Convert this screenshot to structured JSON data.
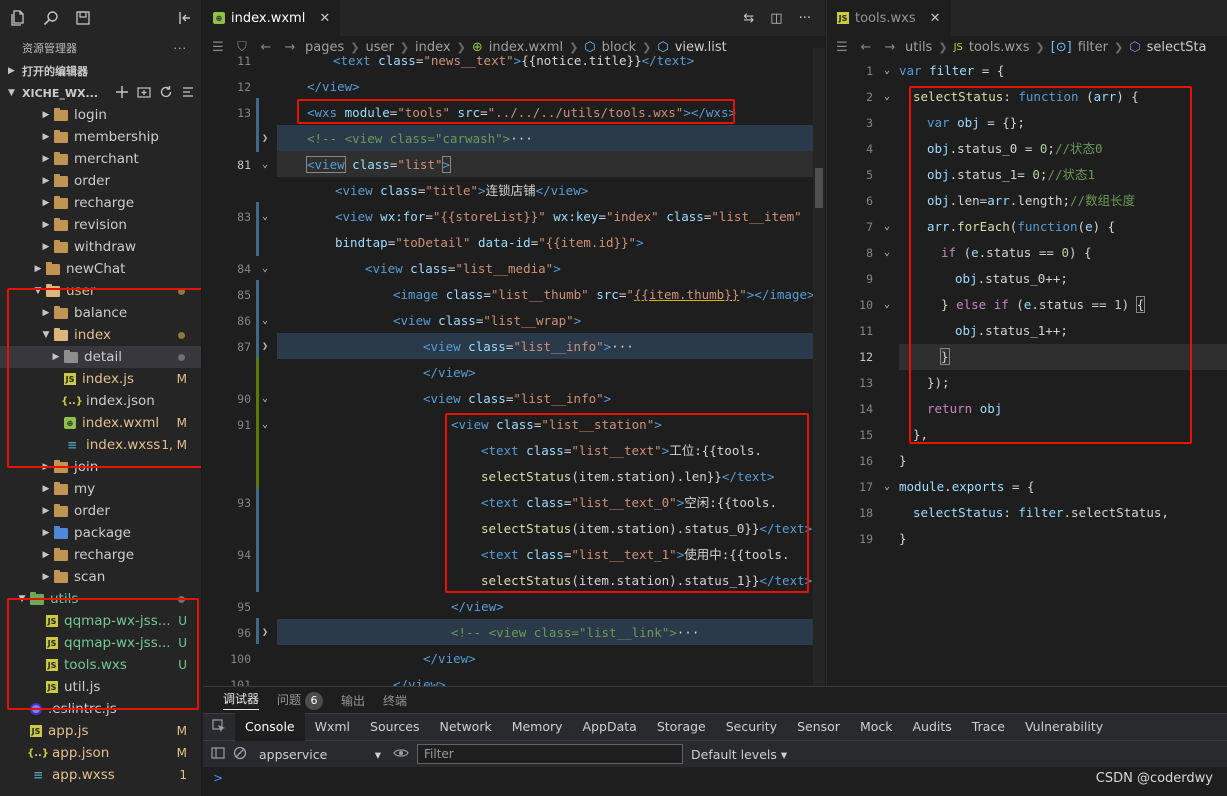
{
  "explorer": {
    "title": "资源管理器",
    "more": "···",
    "open_editors": "打开的编辑器",
    "workspace": "XICHE_WX...",
    "tree": [
      {
        "label": "login",
        "type": "folder",
        "depth": 2
      },
      {
        "label": "membership",
        "type": "folder",
        "depth": 2
      },
      {
        "label": "merchant",
        "type": "folder",
        "depth": 2
      },
      {
        "label": "order",
        "type": "folder",
        "depth": 2
      },
      {
        "label": "recharge",
        "type": "folder",
        "depth": 2
      },
      {
        "label": "revision",
        "type": "folder",
        "depth": 2
      },
      {
        "label": "withdraw",
        "type": "folder",
        "depth": 2
      },
      {
        "label": "newChat",
        "type": "folder",
        "depth": 1
      },
      {
        "label": "user",
        "type": "folder-open",
        "depth": 1,
        "dot": true
      },
      {
        "label": "balance",
        "type": "folder",
        "depth": 2
      },
      {
        "label": "index",
        "type": "folder-open",
        "depth": 2,
        "dot": true
      },
      {
        "label": "detail",
        "type": "folder-dark",
        "depth": 3,
        "dot": true
      },
      {
        "label": "index.js",
        "type": "js",
        "depth": 3,
        "badge": "M"
      },
      {
        "label": "index.json",
        "type": "json",
        "depth": 3
      },
      {
        "label": "index.wxml",
        "type": "wxml",
        "depth": 3,
        "badge": "M"
      },
      {
        "label": "index.wxss",
        "type": "wxss",
        "depth": 3,
        "badge": "1, M"
      },
      {
        "label": "join",
        "type": "folder",
        "depth": 2
      },
      {
        "label": "my",
        "type": "folder",
        "depth": 2
      },
      {
        "label": "order",
        "type": "folder",
        "depth": 2
      },
      {
        "label": "package",
        "type": "folder-blue",
        "depth": 2
      },
      {
        "label": "recharge",
        "type": "folder",
        "depth": 2
      },
      {
        "label": "scan",
        "type": "folder",
        "depth": 2
      },
      {
        "label": "utils",
        "type": "folder-green",
        "depth": 0,
        "dot": true
      },
      {
        "label": "qqmap-wx-jss...",
        "type": "js",
        "depth": 1,
        "badge": "U"
      },
      {
        "label": "qqmap-wx-jss...",
        "type": "js",
        "depth": 1,
        "badge": "U"
      },
      {
        "label": "tools.wxs",
        "type": "js",
        "depth": 1,
        "badge": "U"
      },
      {
        "label": "util.js",
        "type": "js",
        "depth": 1
      },
      {
        "label": ".eslintrc.js",
        "type": "eslint",
        "depth": 0
      },
      {
        "label": "app.js",
        "type": "js",
        "depth": 0,
        "badge": "M"
      },
      {
        "label": "app.json",
        "type": "json",
        "depth": 0,
        "badge": "M"
      },
      {
        "label": "app.wxss",
        "type": "wxss",
        "depth": 0,
        "badge": "1"
      }
    ]
  },
  "editor1": {
    "tab": "index.wxml",
    "breadcrumb": [
      "pages",
      "user",
      "index",
      "index.wxml",
      "block",
      "view.list"
    ]
  },
  "editor2": {
    "tab": "tools.wxs",
    "breadcrumb": [
      "utils",
      "tools.wxs",
      "filter",
      "selectSta"
    ]
  },
  "panel": {
    "tabs": [
      "调试器",
      "问题",
      "输出",
      "终端"
    ],
    "problems_count": "6",
    "devtools_tabs": [
      "Console",
      "Wxml",
      "Sources",
      "Network",
      "Memory",
      "AppData",
      "Storage",
      "Security",
      "Sensor",
      "Mock",
      "Audits",
      "Trace",
      "Vulnerability"
    ],
    "context": "appservice",
    "filter_placeholder": "Filter",
    "levels": "Default levels",
    "prompt": ">"
  },
  "watermark": "CSDN @coderdwy",
  "colors": {
    "accent_box": "#e51400",
    "modified": "#e2c08d",
    "untracked": "#73c991"
  }
}
